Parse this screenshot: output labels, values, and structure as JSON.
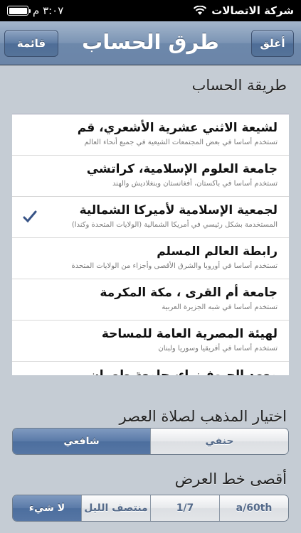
{
  "status_bar": {
    "carrier": "شركة الاتصالات",
    "time": "٣:٠٧ م"
  },
  "nav": {
    "title": "طرق الحساب",
    "close_label": "أغلق",
    "back_label": "قائمة"
  },
  "calc_section_label": "طريقة الحساب",
  "methods": [
    {
      "title": "لشيعة الاثني عشرية الأشعري، قم",
      "subtitle": "تستخدم أساسا في بعض المجتمعات الشيعية في جميع أنحاء العالم",
      "selected": false
    },
    {
      "title": "جامعة العلوم الإسلامية، كراتشي",
      "subtitle": "تستخدم أساسا في باكستان، أفغانستان وبنغلاديش والهند",
      "selected": false
    },
    {
      "title": "لجمعية الإسلامية لأميركا الشمالية",
      "subtitle": "المستخدمة بشكل رئيسي في أمريكا الشمالية (الولايات المتحدة وكندا)",
      "selected": true
    },
    {
      "title": "رابطة العالم المسلم",
      "subtitle": "تستخدم أساسا في أوروبا والشرق الأقصى وأجزاء من الولايات المتحدة",
      "selected": false
    },
    {
      "title": "جامعة أم القرى ، مكة المكرمة",
      "subtitle": "تستخدم أساسا في شبه الجزيرة العربية",
      "selected": false
    },
    {
      "title": "لهيئة المصرية العامة للمساحة",
      "subtitle": "تستخدم أساسا في أفريقيا وسوريا ولبنان",
      "selected": false
    },
    {
      "title": "معهد الجيوفيزياء، جامعة طهران",
      "subtitle": "",
      "selected": false
    }
  ],
  "asr_section_label": "اختيار المذهب لصلاة العصر",
  "asr_options": [
    {
      "label": "شافعي",
      "selected": true
    },
    {
      "label": "حنفي",
      "selected": false
    }
  ],
  "latitude_section_label": "أقصى خط العرض",
  "latitude_options": [
    {
      "label": "لا شيء",
      "selected": true
    },
    {
      "label": "منتصف الليل",
      "selected": false
    },
    {
      "label": "1/7",
      "selected": false
    },
    {
      "label": "a/60th",
      "selected": false
    }
  ],
  "colors": {
    "check": "#385487",
    "nav_blue": "#6d88ab",
    "background": "#c5ccd4"
  }
}
